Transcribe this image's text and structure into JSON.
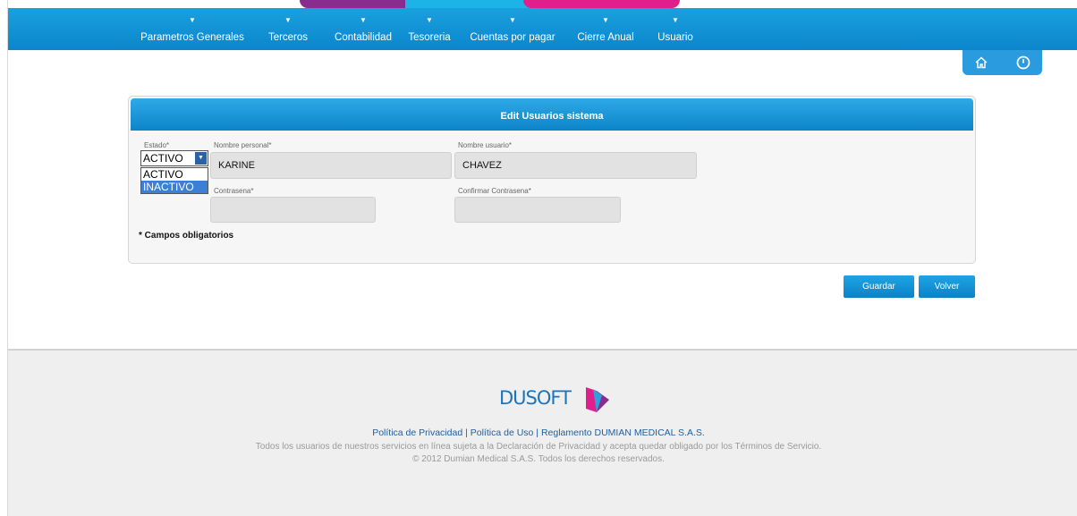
{
  "nav": {
    "items": [
      {
        "label": "Parametros Generales"
      },
      {
        "label": "Terceros"
      },
      {
        "label": "Contabilidad"
      },
      {
        "label": "Tesoreria"
      },
      {
        "label": "Cuentas por pagar"
      },
      {
        "label": "Cierre Anual"
      },
      {
        "label": "Usuario"
      }
    ],
    "caret": "▼"
  },
  "toolbar": {
    "icons": [
      "home-icon",
      "power-icon"
    ]
  },
  "form": {
    "title": "Edit Usuarios sistema",
    "estado_label": "Estado*",
    "estado_value": "ACTIVO",
    "estado_options": [
      "ACTIVO",
      "INACTIVO"
    ],
    "nombre_personal_label": "Nombre personal*",
    "nombre_personal_value": "KARINE",
    "nombre_usuario_label": "Nombre usuario*",
    "nombre_usuario_value": "CHAVEZ",
    "contrasena_label": "Contrasena*",
    "contrasena_value": "",
    "confirmar_label": "Confirmar Contrasena*",
    "confirmar_value": "",
    "required_note": "* Campos obligatorios"
  },
  "actions": {
    "save_label": "Guardar",
    "back_label": "Volver"
  },
  "footer": {
    "logo_text": "DUSOFT",
    "link_privacy": "Política de Privacidad",
    "link_use": "Política de Uso",
    "link_rules": "Reglamento DUMIAN MEDICAL S.A.S.",
    "separator": "|",
    "disclaimer": "Todos los usuarios de nuestros servicios en línea sujeta a la Declaración de Privacidad y acepta quedar obligado por los Términos de Servicio.",
    "copyright": "© 2012 Dumian Medical S.A.S. Todos los derechos reservados."
  },
  "colors": {
    "nav_blue": "#0b86cc",
    "accent_purple": "#8a2b8f",
    "accent_pink": "#e01f8c",
    "accent_cyan": "#1cb4e8"
  }
}
